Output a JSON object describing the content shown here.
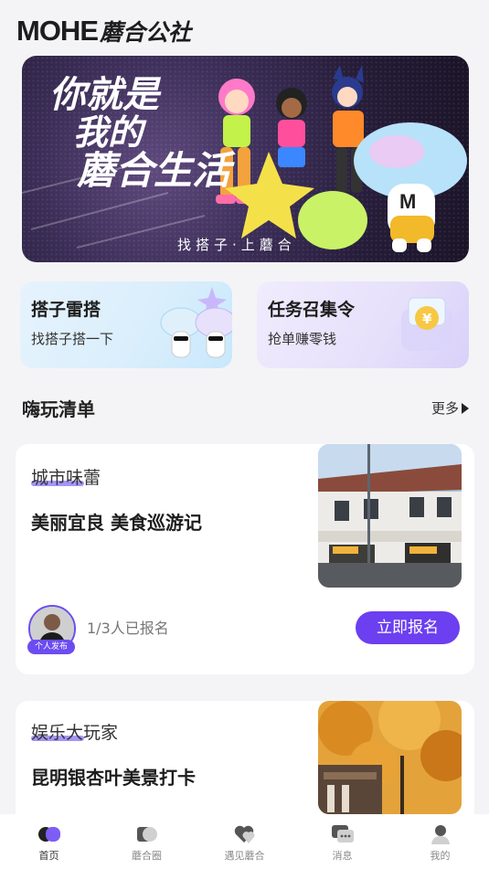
{
  "header": {
    "logo_en": "MOHE",
    "logo_cn": "蘑合公社"
  },
  "banner": {
    "slogan_line1": "你就是",
    "slogan_line2": "我的",
    "slogan_line3": "蘑合生活",
    "tagline": "找搭子·上蘑合"
  },
  "features": [
    {
      "title": "搭子雷搭",
      "subtitle": "找搭子搭一下"
    },
    {
      "title": "任务召集令",
      "subtitle": "抢单赚零钱"
    }
  ],
  "section": {
    "title": "嗨玩清单",
    "more": "更多"
  },
  "cards": [
    {
      "category": "城市味蕾",
      "title": "美丽宜良 美食巡游记",
      "avatar_badge": "个人发布",
      "enroll_count": "1/3人已报名",
      "button": "立即报名"
    },
    {
      "category": "娱乐大玩家",
      "title": "昆明银杏叶美景打卡"
    }
  ],
  "tabbar": [
    {
      "label": "首页",
      "icon": "home-icon",
      "active": true
    },
    {
      "label": "蘑合圈",
      "icon": "circle-icon",
      "active": false
    },
    {
      "label": "遇见蘑合",
      "icon": "heart-icon",
      "active": false
    },
    {
      "label": "消息",
      "icon": "message-icon",
      "active": false
    },
    {
      "label": "我的",
      "icon": "profile-icon",
      "active": false
    }
  ],
  "colors": {
    "accent": "#6c3ff0",
    "background": "#f4f4f6"
  }
}
